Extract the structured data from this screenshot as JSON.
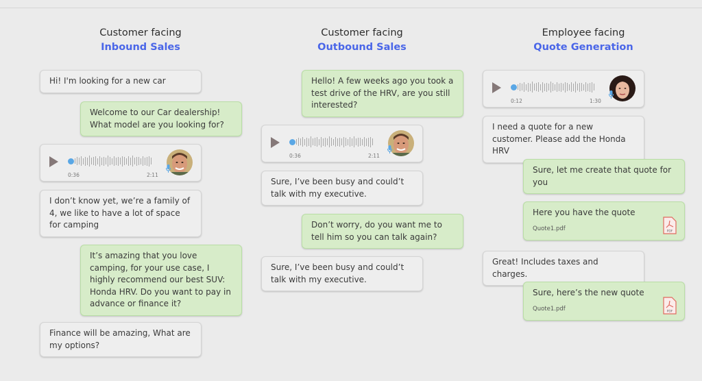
{
  "columns": [
    {
      "subtitle": "Customer facing",
      "title": "Inbound Sales",
      "messages": [
        {
          "type": "text",
          "side": "left",
          "text": "Hi! I'm looking for a new car"
        },
        {
          "type": "text",
          "side": "right",
          "text": "Welcome to our Car dealership! What model are you looking for?"
        },
        {
          "type": "audio",
          "side": "left",
          "elapsed": "0:36",
          "duration": "2:11",
          "avatar": "man-avatar",
          "progress": 0.0
        },
        {
          "type": "text",
          "side": "left",
          "text": "I don’t know yet, we’re a family of 4, we like to have a  lot of space for camping"
        },
        {
          "type": "text",
          "side": "right",
          "text": "It’s amazing that you love camping, for your use case, I highly recommend our best SUV: Honda HRV. Do you want to pay in advance or finance it?"
        },
        {
          "type": "text",
          "side": "left",
          "text": "Finance will be amazing, What are my options?"
        }
      ]
    },
    {
      "subtitle": "Customer facing",
      "title": "Outbound Sales",
      "messages": [
        {
          "type": "text",
          "side": "right",
          "text": "Hello! A few weeks ago you took a test drive of the HRV, are you still interested?"
        },
        {
          "type": "audio",
          "side": "left",
          "elapsed": "0:36",
          "duration": "2:11",
          "avatar": "man-avatar",
          "progress": 0.0
        },
        {
          "type": "text",
          "side": "left",
          "text": "Sure, I’ve been busy and could’t talk with my executive."
        },
        {
          "type": "text",
          "side": "right",
          "text": "Don’t worry, do you want me to tell him so you can talk again?"
        },
        {
          "type": "text",
          "side": "left",
          "text": "Sure, I’ve been busy  and could’t talk with my executive."
        }
      ]
    },
    {
      "subtitle": "Employee facing",
      "title": "Quote Generation",
      "messages": [
        {
          "type": "audio",
          "side": "left",
          "elapsed": "0:12",
          "duration": "1:30",
          "avatar": "woman-avatar",
          "progress": 0.0
        },
        {
          "type": "text",
          "side": "left",
          "text": "I need a quote for a new customer. Please add the Honda HRV"
        },
        {
          "type": "text",
          "side": "right",
          "text": "Sure, let me create that quote for you"
        },
        {
          "type": "file",
          "side": "right",
          "text": "Here you have the quote",
          "file": "Quote1.pdf",
          "file_icon": "pdf-icon"
        },
        {
          "type": "text",
          "side": "left",
          "text": "Great! Includes taxes and charges."
        },
        {
          "type": "file",
          "side": "right",
          "text": "Sure, here’s the new quote",
          "file": "Quote1.pdf",
          "file_icon": "pdf-icon"
        }
      ]
    }
  ],
  "colors": {
    "accent": "#4a66e8",
    "agent_bubble": "#d7ecc9",
    "user_bubble": "#eeeeee",
    "background": "#ebebeb",
    "audio_progress": "#5aa7e5"
  }
}
